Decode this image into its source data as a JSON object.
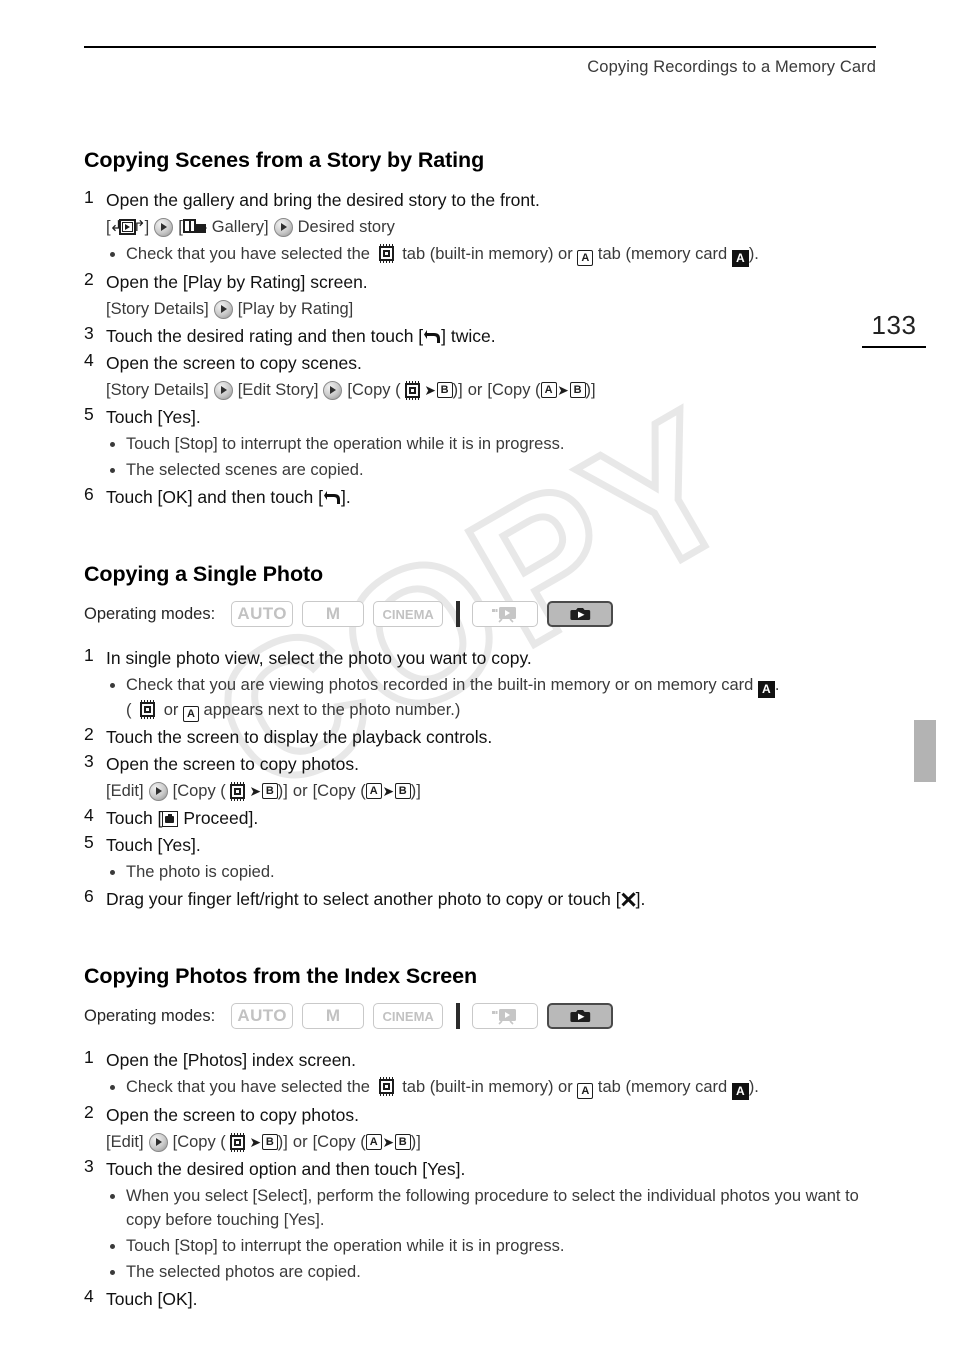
{
  "header": {
    "running_head": "Copying Recordings to a Memory Card"
  },
  "folio": {
    "page_number": "133"
  },
  "watermark": {
    "text": "COPY"
  },
  "operating_modes": {
    "label": "Operating modes:",
    "badges": [
      {
        "label": "AUTO",
        "state": "inactive",
        "icon": ""
      },
      {
        "label": "M",
        "state": "inactive",
        "icon": ""
      },
      {
        "label": "CINEMA",
        "state": "inactive",
        "icon": ""
      },
      {
        "label": "",
        "state": "inactive",
        "icon": "video-playback-icon"
      },
      {
        "label": "",
        "state": "active",
        "icon": "photo-playback-icon"
      }
    ]
  },
  "sections": [
    {
      "title": "Copying Scenes from a Story by Rating",
      "steps": [
        {
          "num": "1",
          "text": "Open the gallery and bring the desired story to the front.",
          "path": {
            "prefix_open": "[",
            "icon1": "playback-mode-icon",
            "close1": "]",
            "open2": "[",
            "icon2": "gallery-icon",
            "label2": "Gallery]",
            "tail": "Desired story"
          },
          "bullets": [
            {
              "pre": "Check that you have selected the",
              "mid": "tab (built-in memory) or",
              "mid2": "tab (memory card",
              "post": ")."
            }
          ]
        },
        {
          "num": "2",
          "text": "Open the [Play by Rating] screen.",
          "path_simple": {
            "left": "[Story Details]",
            "right": "[Play by Rating]"
          }
        },
        {
          "num": "3",
          "text_pre": "Touch the desired rating and then touch [",
          "text_post": "] twice."
        },
        {
          "num": "4",
          "text": "Open the screen to copy scenes.",
          "copy_path": {
            "p1": "[Story Details]",
            "p2": "[Edit Story]",
            "p3_open": "[Copy (",
            "p3_close": ")]",
            "or": "or",
            "p4_open": "[Copy (",
            "p4_close": ")]",
            "cardA": "A",
            "cardB": "B"
          }
        },
        {
          "num": "5",
          "text": "Touch [Yes].",
          "bullets_plain": [
            "Touch [Stop] to interrupt the operation while it is in progress.",
            "The selected scenes are copied."
          ]
        },
        {
          "num": "6",
          "text_pre": "Touch [OK] and then touch [",
          "text_post": "]."
        }
      ]
    },
    {
      "title": "Copying a Single Photo",
      "steps": [
        {
          "num": "1",
          "text": "In single photo view, select the photo you want to copy.",
          "bullets": [
            {
              "pre": "Check that you are viewing photos recorded in the built-in memory or on memory card",
              "post": ".",
              "line2_pre": "(",
              "line2_mid": "or",
              "line2_post": "appears next to the photo number.)"
            }
          ]
        },
        {
          "num": "2",
          "text": "Touch the screen to display the playback controls."
        },
        {
          "num": "3",
          "text": "Open the screen to copy photos.",
          "copy_path": {
            "p1": "[Edit]",
            "p3_open": "[Copy (",
            "p3_close": ")]",
            "or": "or",
            "p4_open": "[Copy (",
            "p4_close": ")]",
            "cardA": "A",
            "cardB": "B"
          }
        },
        {
          "num": "4",
          "text_pre": "Touch [",
          "text_post": "Proceed]."
        },
        {
          "num": "5",
          "text": "Touch [Yes].",
          "bullets_plain": [
            "The photo is copied."
          ]
        },
        {
          "num": "6",
          "text_pre": "Drag your finger left/right to select another photo to copy or touch [",
          "text_post": "]."
        }
      ]
    },
    {
      "title": "Copying Photos from the Index Screen",
      "steps": [
        {
          "num": "1",
          "text": "Open the [Photos] index screen.",
          "bullets": [
            {
              "pre": "Check that you have selected the",
              "mid": "tab (built-in memory) or",
              "mid2": "tab (memory card",
              "post": ")."
            }
          ]
        },
        {
          "num": "2",
          "text": "Open the screen to copy photos.",
          "copy_path": {
            "p1": "[Edit]",
            "p3_open": "[Copy (",
            "p3_close": ")]",
            "or": "or",
            "p4_open": "[Copy (",
            "p4_close": ")]",
            "cardA": "A",
            "cardB": "B"
          }
        },
        {
          "num": "3",
          "text": "Touch the desired option and then touch [Yes].",
          "bullets_plain": [
            "When you select [Select], perform the following procedure to select the individual photos you want to copy before touching [Yes].",
            "Touch [Stop] to interrupt the operation while it is in progress.",
            "The selected photos are copied."
          ]
        },
        {
          "num": "4",
          "text": "Touch [OK]."
        }
      ]
    }
  ]
}
